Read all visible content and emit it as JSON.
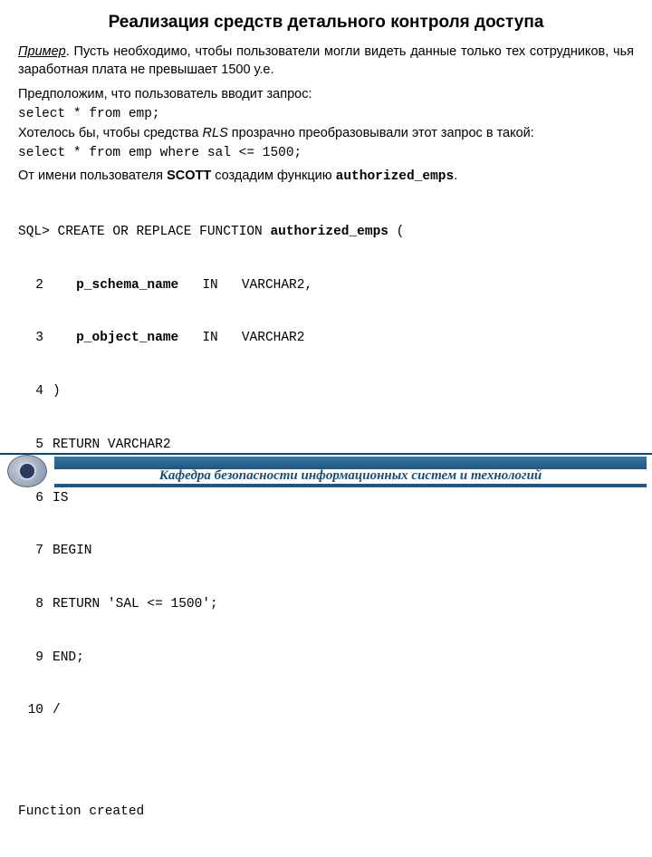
{
  "title": "Реализация средств детального контроля доступа",
  "example_label": "Пример",
  "example_text": ". Пусть необходимо, чтобы пользователи могли видеть данные только тех сотрудников, чья заработная плата не превышает 1500 у.е.",
  "assume_text": "Предположим, что пользователь вводит запрос:",
  "query1": "select * from emp;",
  "want_pre": "Хотелось бы, чтобы средства ",
  "want_rls": "RLS",
  "want_post": " прозрачно преобразовывали этот запрос в такой:",
  "query2": "select * from emp where sal <= 1500;",
  "scott_pre": "От имени пользователя ",
  "scott_name": "SCOTT",
  "scott_mid": " создадим функцию ",
  "scott_fn": "authorized_emps",
  "scott_post": ".",
  "code": {
    "l1_pre": "SQL> CREATE OR REPLACE FUNCTION ",
    "l1_fn": "authorized_emps",
    "l1_post": " (",
    "lines": [
      {
        "n": "2",
        "pre": "   ",
        "b": "p_schema_name",
        "post": "   IN   VARCHAR2,"
      },
      {
        "n": "3",
        "pre": "   ",
        "b": "p_object_name",
        "post": "   IN   VARCHAR2"
      },
      {
        "n": "4",
        "t": ")"
      },
      {
        "n": "5",
        "t": "RETURN VARCHAR2"
      },
      {
        "n": "6",
        "t": "IS"
      },
      {
        "n": "7",
        "t": "BEGIN"
      },
      {
        "n": "8",
        "t": "RETURN 'SAL <= 1500';"
      },
      {
        "n": "9",
        "t": "END;"
      },
      {
        "n": "10",
        "t": "/"
      }
    ],
    "result": "Function created"
  },
  "footer": "Кафедра безопасности информационных систем и технологий"
}
